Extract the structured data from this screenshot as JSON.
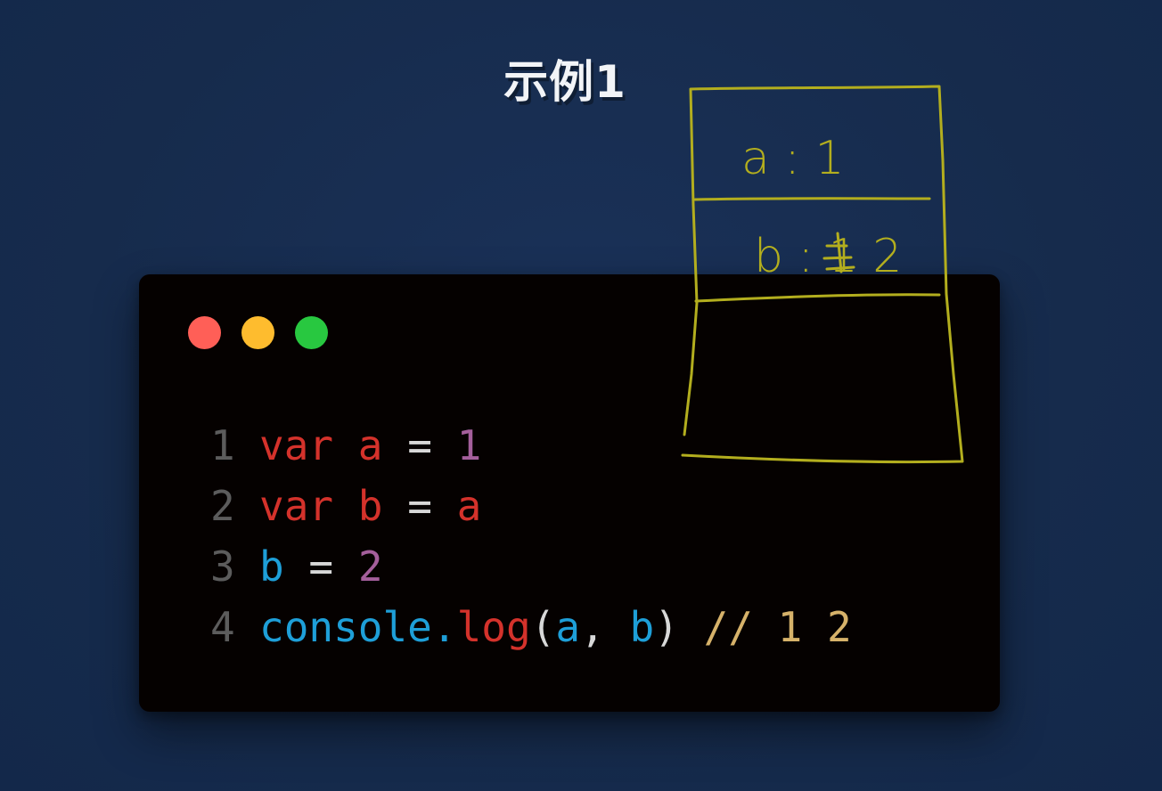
{
  "title": "示例1",
  "window": {
    "background": "#050100",
    "buttons": [
      {
        "name": "close",
        "color": "#ff5f57"
      },
      {
        "name": "minimize",
        "color": "#febc2e"
      },
      {
        "name": "zoom",
        "color": "#28c840"
      }
    ]
  },
  "code": {
    "lines": [
      {
        "no": "1",
        "tokens": [
          {
            "text": "var",
            "color": "#d4322b"
          },
          {
            "text": " "
          },
          {
            "text": "a",
            "color": "#d4322b"
          },
          {
            "text": " "
          },
          {
            "text": "=",
            "color": "#d8d8d8"
          },
          {
            "text": " "
          },
          {
            "text": "1",
            "color": "#a45f9b"
          }
        ]
      },
      {
        "no": "2",
        "tokens": [
          {
            "text": "var",
            "color": "#d4322b"
          },
          {
            "text": " "
          },
          {
            "text": "b",
            "color": "#d4322b"
          },
          {
            "text": " "
          },
          {
            "text": "=",
            "color": "#d8d8d8"
          },
          {
            "text": " "
          },
          {
            "text": "a",
            "color": "#d4322b"
          }
        ]
      },
      {
        "no": "3",
        "tokens": [
          {
            "text": "b",
            "color": "#1e9fd8"
          },
          {
            "text": " "
          },
          {
            "text": "=",
            "color": "#d8d8d8"
          },
          {
            "text": " "
          },
          {
            "text": "2",
            "color": "#a45f9b"
          }
        ]
      },
      {
        "no": "4",
        "tokens": [
          {
            "text": "console.",
            "color": "#1e9fd8"
          },
          {
            "text": "log",
            "color": "#d4322b"
          },
          {
            "text": "(",
            "color": "#d8d8d8"
          },
          {
            "text": "a",
            "color": "#1e9fd8"
          },
          {
            "text": ", ",
            "color": "#d8d8d8"
          },
          {
            "text": "b",
            "color": "#1e9fd8"
          },
          {
            "text": ")",
            "color": "#d8d8d8"
          },
          {
            "text": " "
          },
          {
            "text": "// 1 2",
            "color": "#d6b26a"
          }
        ]
      }
    ]
  },
  "annotation": {
    "color": "#b3ae1e",
    "cell1": "a : 1",
    "cell2": "b : 1 2"
  }
}
